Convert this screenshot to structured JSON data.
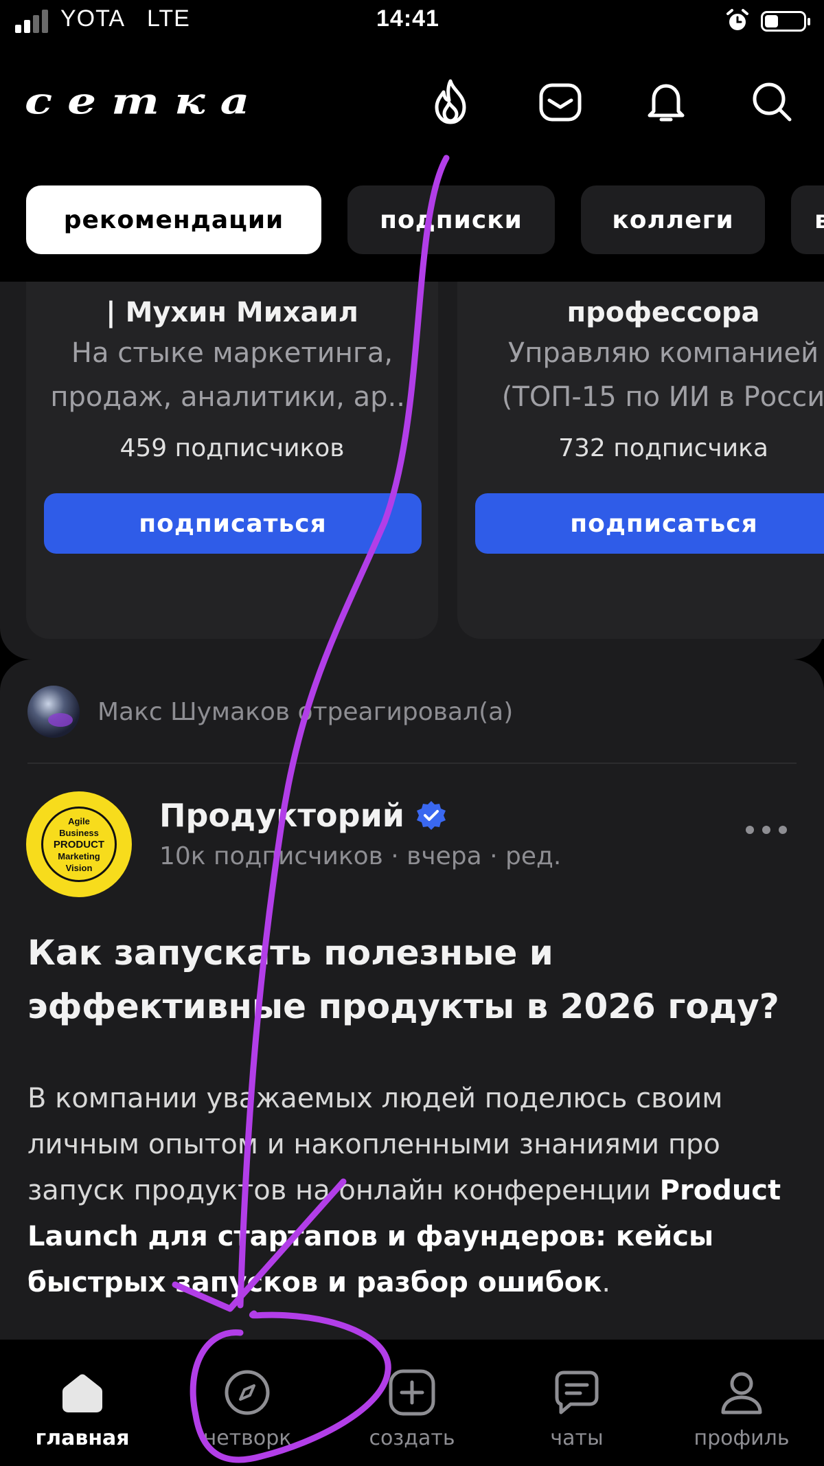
{
  "status_bar": {
    "carrier": "YOTA",
    "network": "LTE",
    "time": "14:41",
    "battery_level": 0.35,
    "icons": [
      "signal-icon",
      "alarm-icon",
      "battery-icon"
    ]
  },
  "header": {
    "logo": "сетка",
    "icons": [
      "fire-icon",
      "mail-icon",
      "bell-icon",
      "search-icon"
    ],
    "tabs": [
      {
        "label": "рекомендации",
        "active": true
      },
      {
        "label": "подписки",
        "active": false
      },
      {
        "label": "коллеги",
        "active": false
      },
      {
        "label": "в",
        "active": false
      }
    ]
  },
  "recommendations": [
    {
      "name": "| Мухин Михаил",
      "description_lines": [
        "На стыке маркетинга,",
        "продаж, аналитики, ар..."
      ],
      "subscribers": "459 подписчиков",
      "button": "подписаться"
    },
    {
      "name": "профессора",
      "description_lines": [
        "Управляю компанией",
        "(ТОП-15 по ИИ в Росси"
      ],
      "subscribers": "732 подписчика",
      "button": "подписаться"
    }
  ],
  "post": {
    "reaction_text": "Макс Шумаков отреагировал(а)",
    "author": {
      "name": "Продукторий",
      "meta": "10к подписчиков · вчера · ред.",
      "avatar_lines": [
        "Agile",
        "Business",
        "PRODUCT",
        "Marketing",
        "Vision"
      ]
    },
    "title": "Как запускать полезные и эффективные продукты в 2026 году?",
    "body_intro": "В компании уважаемых людей поделюсь своим личным опытом и накопленными знаниями про запуск продуктов на онлайн конференции",
    "body_bold": "Product Launch для стартапов и фаундеров: кейсы быстрых запусков и разбор ошибок",
    "body_end": "."
  },
  "bottom_nav": [
    {
      "label": "главная",
      "icon": "home-icon",
      "active": true
    },
    {
      "label": "нетворк",
      "icon": "compass-icon",
      "active": false
    },
    {
      "label": "создать",
      "icon": "plus-square-icon",
      "active": false
    },
    {
      "label": "чаты",
      "icon": "chat-icon",
      "active": false
    },
    {
      "label": "профиль",
      "icon": "person-icon",
      "active": false
    }
  ],
  "colors": {
    "background": "#000000",
    "card": "#1c1c1e",
    "accent_button": "#2f5ce8",
    "verified": "#3a68f0",
    "annotation": "#b23ee8"
  }
}
